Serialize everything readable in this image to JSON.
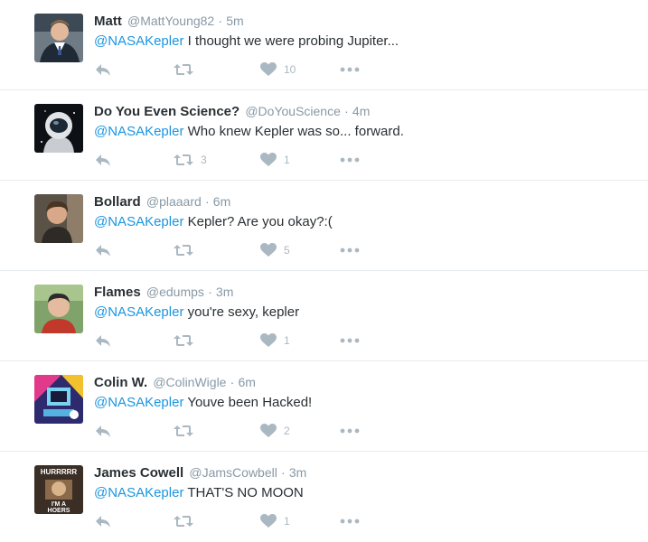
{
  "colors": {
    "link": "#1b95e0",
    "text": "#292f33",
    "muted": "#8899a6",
    "icon": "#aab8c2",
    "divider": "#e6ecf0"
  },
  "icons": [
    "reply-icon",
    "retweet-icon",
    "heart-icon",
    "more-options-icon"
  ],
  "tweets": [
    {
      "name": "Matt",
      "handle": "@MattYoung82",
      "sep": "·",
      "time": "5m",
      "mention": "@NASAKepler",
      "text": " I thought we were probing Jupiter...",
      "retweets": "",
      "likes": "10"
    },
    {
      "name": "Do You Even Science?",
      "handle": "@DoYouScience",
      "sep": "·",
      "time": "4m",
      "mention": "@NASAKepler",
      "text": " Who knew Kepler was so... forward.",
      "retweets": "3",
      "likes": "1"
    },
    {
      "name": "Bollard",
      "handle": "@plaaard",
      "sep": "·",
      "time": "6m",
      "mention": "@NASAKepler",
      "text": " Kepler? Are you okay?:(",
      "retweets": "",
      "likes": "5"
    },
    {
      "name": "Flames",
      "handle": "@edumps",
      "sep": "·",
      "time": "3m",
      "mention": "@NASAKepler",
      "text": " you're sexy, kepler",
      "retweets": "",
      "likes": "1"
    },
    {
      "name": "Colin W.",
      "handle": "@ColinWigle",
      "sep": "·",
      "time": "6m",
      "mention": "@NASAKepler",
      "text": " Youve been Hacked!",
      "retweets": "",
      "likes": "2"
    },
    {
      "name": "James Cowell",
      "handle": "@JamsCowbell",
      "sep": "·",
      "time": "3m",
      "mention": "@NASAKepler",
      "text": " THAT'S NO MOON",
      "retweets": "",
      "likes": "1",
      "avatar_text_top": "HURRRRR",
      "avatar_text_bottom_1": "I'M A",
      "avatar_text_bottom_2": "HOERS"
    }
  ]
}
